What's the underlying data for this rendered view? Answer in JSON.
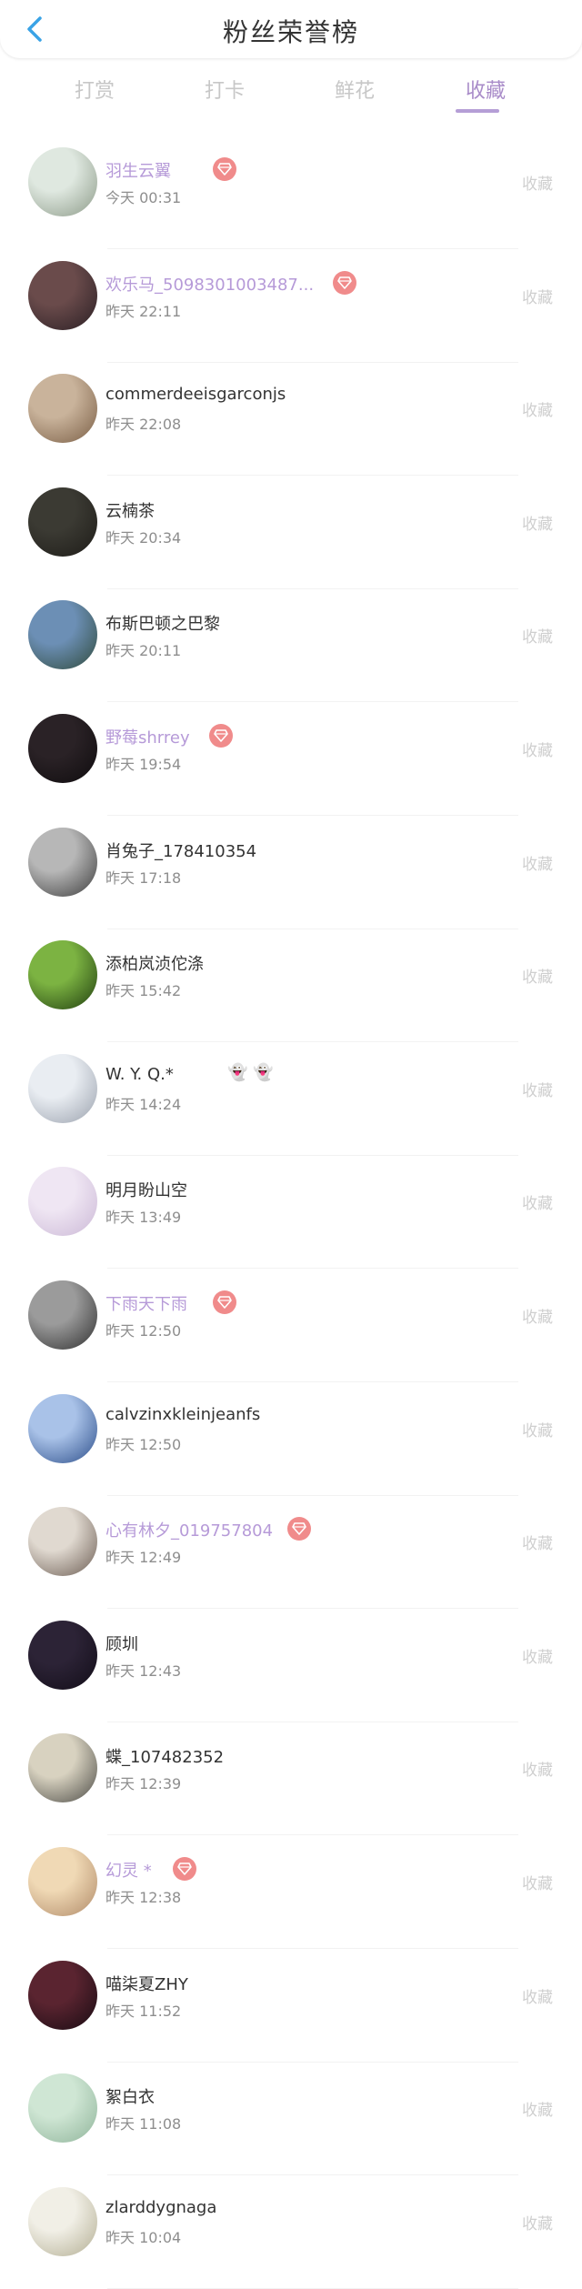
{
  "header": {
    "title": "粉丝荣誉榜"
  },
  "tabs": [
    {
      "label": "打赏",
      "active": false
    },
    {
      "label": "打卡",
      "active": false
    },
    {
      "label": "鲜花",
      "active": false
    },
    {
      "label": "收藏",
      "active": true
    }
  ],
  "colors": {
    "accent": "#b59ed6",
    "vip_name": "#b69ad8",
    "badge": "#f08b8b",
    "muted": "#c7c7c7"
  },
  "action_label": "收藏",
  "fans": [
    {
      "name": "羽生云翼",
      "time": "今天 00:31",
      "vip": true,
      "badge": true
    },
    {
      "name": "欢乐马_5098301003487...",
      "time": "昨天 22:11",
      "vip": true,
      "badge": true
    },
    {
      "name": "commerdeeisgarconjs",
      "time": "昨天 22:08",
      "vip": false,
      "badge": false
    },
    {
      "name": "云楠茶",
      "time": "昨天 20:34",
      "vip": false,
      "badge": false
    },
    {
      "name": "布斯巴顿之巴黎",
      "time": "昨天 20:11",
      "vip": false,
      "badge": false
    },
    {
      "name": "野莓shrrey",
      "time": "昨天 19:54",
      "vip": true,
      "badge": true
    },
    {
      "name": "肖兔子_178410354",
      "time": "昨天 17:18",
      "vip": false,
      "badge": false
    },
    {
      "name": "添柏岚浈佗涤",
      "time": "昨天 15:42",
      "vip": false,
      "badge": false
    },
    {
      "name": "W. Y. Q.*",
      "time": "昨天 14:24",
      "vip": false,
      "badge": false,
      "ghosts": "👻 👻"
    },
    {
      "name": "明月盼山空",
      "time": "昨天 13:49",
      "vip": false,
      "badge": false
    },
    {
      "name": "下雨天下雨",
      "time": "昨天 12:50",
      "vip": true,
      "badge": true
    },
    {
      "name": "calvzinxkleinjeanfs",
      "time": "昨天 12:50",
      "vip": false,
      "badge": false
    },
    {
      "name": "心有林夕_019757804",
      "time": "昨天 12:49",
      "vip": true,
      "badge": true
    },
    {
      "name": "顾圳",
      "time": "昨天 12:43",
      "vip": false,
      "badge": false
    },
    {
      "name": "蝶_107482352",
      "time": "昨天 12:39",
      "vip": false,
      "badge": false
    },
    {
      "name": "幻灵 *",
      "time": "昨天 12:38",
      "vip": true,
      "badge": true
    },
    {
      "name": "喵柒夏ZHY",
      "time": "昨天 11:52",
      "vip": false,
      "badge": false
    },
    {
      "name": "絮白衣",
      "time": "昨天 11:08",
      "vip": false,
      "badge": false
    },
    {
      "name": "zlarddygnaga",
      "time": "昨天 10:04",
      "vip": false,
      "badge": false
    }
  ],
  "avatar_colors": [
    [
      "#dfe8e0",
      "#8c9a88"
    ],
    [
      "#6a4b4b",
      "#2a1f24"
    ],
    [
      "#c9b39b",
      "#7a5e45"
    ],
    [
      "#3b3a33",
      "#1e1c18"
    ],
    [
      "#6c8fb5",
      "#2f4a3b"
    ],
    [
      "#2a2226",
      "#0f0c0e"
    ],
    [
      "#b7b7b7",
      "#3c3c3c"
    ],
    [
      "#7cb342",
      "#1f3d0f"
    ],
    [
      "#e9edf2",
      "#9aa1ad"
    ],
    [
      "#efe6f3",
      "#cbb8d6"
    ],
    [
      "#9b9b9b",
      "#2f2f2f"
    ],
    [
      "#a9c2e8",
      "#2c4e8a"
    ],
    [
      "#e0d9d0",
      "#6b5c52"
    ],
    [
      "#2c2336",
      "#120d18"
    ],
    [
      "#d8d2c0",
      "#4b4a45"
    ],
    [
      "#f0d9b5",
      "#b08a68"
    ],
    [
      "#5a2430",
      "#170b12"
    ],
    [
      "#cfe6d4",
      "#8fb49a"
    ],
    [
      "#f1efe6",
      "#b3ae93"
    ]
  ]
}
